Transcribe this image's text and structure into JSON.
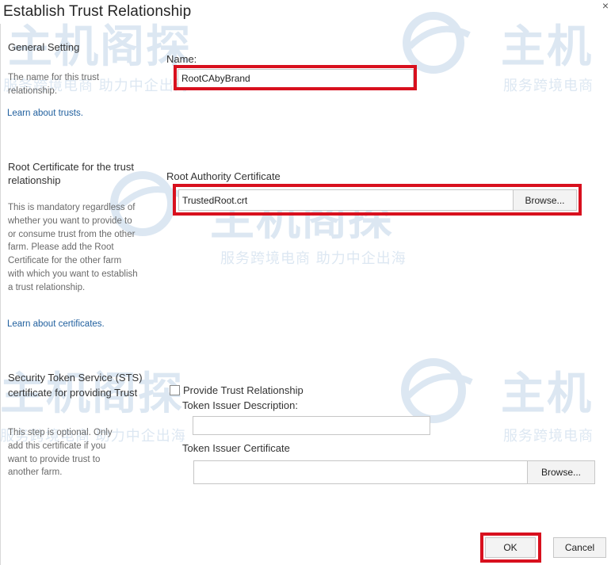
{
  "dialog": {
    "title": "Establish Trust Relationship",
    "close_glyph": "×"
  },
  "general": {
    "heading": "General Setting",
    "description": "The name for this trust relationship.",
    "learn_link": "Learn about trusts.",
    "name_label": "Name:",
    "name_value": "RootCAbyBrand"
  },
  "root_cert": {
    "heading": "Root Certificate for the trust relationship",
    "description": "This is mandatory regardless of whether you want to provide to or consume trust from the other farm. Please add the Root Certificate for the other farm with which you want to establish a trust relationship.",
    "learn_link": "Learn about certificates.",
    "field_label": "Root Authority Certificate",
    "file_value": "TrustedRoot.crt",
    "browse_label": "Browse..."
  },
  "sts": {
    "heading": "Security Token Service (STS) certificate for providing Trust",
    "description": "This step is optional. Only add this certificate if you want to provide trust to another farm.",
    "checkbox_label": "Provide Trust Relationship",
    "checkbox_checked": false,
    "issuer_desc_label": "Token Issuer Description:",
    "issuer_desc_value": "",
    "issuer_cert_label": "Token Issuer Certificate",
    "issuer_cert_value": "",
    "browse_label": "Browse..."
  },
  "footer": {
    "ok_label": "OK",
    "cancel_label": "Cancel"
  },
  "watermark": {
    "brand": "主机阁探",
    "slogan": "服务跨境电商 助力中企出海",
    "slogan_short": "服务跨境电商",
    "brand_short": "主机"
  },
  "colors": {
    "highlight": "#d8101e",
    "link": "#1f5f9e",
    "watermark": "#2f6fb0"
  }
}
